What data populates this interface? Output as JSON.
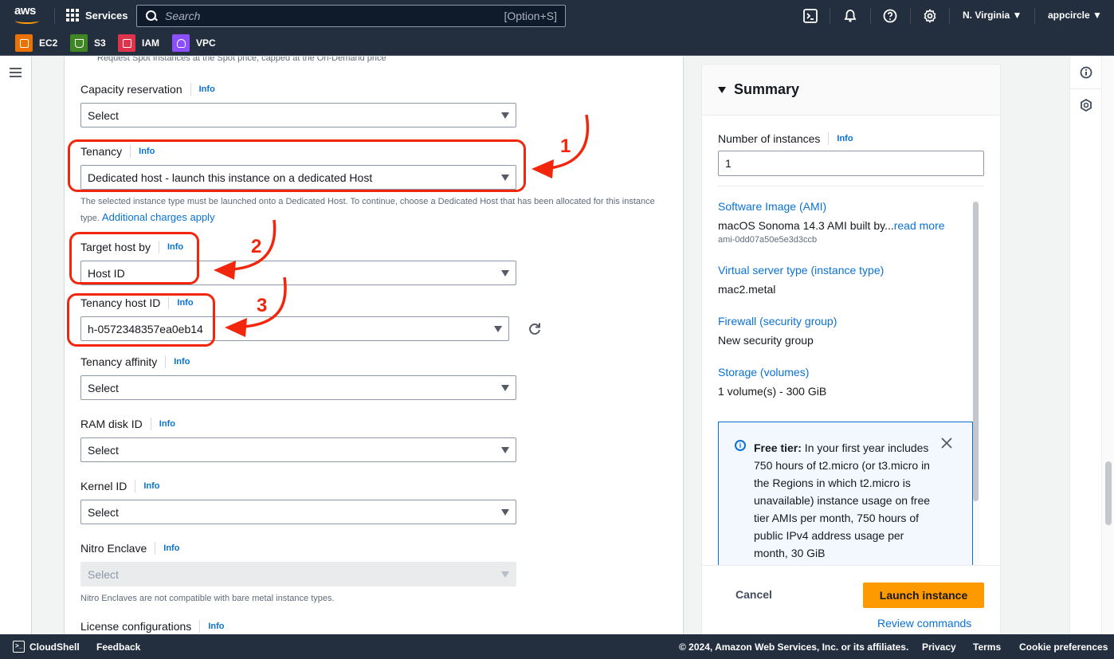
{
  "topnav": {
    "logo_text": "aws",
    "services_label": "Services",
    "search_placeholder": "Search",
    "search_shortcut": "[Option+S]",
    "region": "N. Virginia",
    "account": "appcircle"
  },
  "favorites": [
    {
      "label": "EC2",
      "color": "#ed7100"
    },
    {
      "label": "S3",
      "color": "#3f8624"
    },
    {
      "label": "IAM",
      "color": "#dd344c"
    },
    {
      "label": "VPC",
      "color": "#8c4fff"
    }
  ],
  "form": {
    "spot_description": "Request Spot Instances at the Spot price, capped at the On-Demand price",
    "info_label": "Info",
    "fields": {
      "capacity_reservation": {
        "label": "Capacity reservation",
        "value": "Select"
      },
      "tenancy": {
        "label": "Tenancy",
        "value": "Dedicated host - launch this instance on a dedicated Host",
        "hint": "The selected instance type must be launched onto a Dedicated Host. To continue, choose a Dedicated Host that has been allocated for this instance type.",
        "hint_link": "Additional charges apply"
      },
      "target_host_by": {
        "label": "Target host by",
        "value": "Host ID"
      },
      "tenancy_host_id": {
        "label": "Tenancy host ID",
        "value": "h-0572348357ea0eb14"
      },
      "tenancy_affinity": {
        "label": "Tenancy affinity",
        "value": "Select"
      },
      "ram_disk_id": {
        "label": "RAM disk ID",
        "value": "Select"
      },
      "kernel_id": {
        "label": "Kernel ID",
        "value": "Select"
      },
      "nitro_enclave": {
        "label": "Nitro Enclave",
        "value": "Select",
        "hint": "Nitro Enclaves are not compatible with bare metal instance types."
      },
      "license_configurations": {
        "label": "License configurations"
      }
    },
    "annotations": [
      "1",
      "2",
      "3"
    ]
  },
  "summary": {
    "title": "Summary",
    "num_instances_label": "Number of instances",
    "num_instances_value": "1",
    "items": [
      {
        "label": "Software Image (AMI)",
        "value": "macOS Sonoma 14.3 AMI built by...",
        "link": "read more",
        "sub": "ami-0dd07a50e5e3d3ccb"
      },
      {
        "label": "Virtual server type (instance type)",
        "value": "mac2.metal"
      },
      {
        "label": "Firewall (security group)",
        "value": "New security group"
      },
      {
        "label": "Storage (volumes)",
        "value": "1 volume(s) - 300 GiB"
      }
    ],
    "free_tier_title": "Free tier:",
    "free_tier_text": " In your first year includes 750 hours of t2.micro (or t3.micro in the Regions in which t2.micro is unavailable) instance usage on free tier AMIs per month, 750 hours of public IPv4 address usage per month, 30 GiB",
    "cancel_label": "Cancel",
    "launch_label": "Launch instance",
    "review_label": "Review commands"
  },
  "footer": {
    "cloudshell": "CloudShell",
    "feedback": "Feedback",
    "copyright": "© 2024, Amazon Web Services, Inc. or its affiliates.",
    "privacy": "Privacy",
    "terms": "Terms",
    "cookies": "Cookie preferences"
  }
}
